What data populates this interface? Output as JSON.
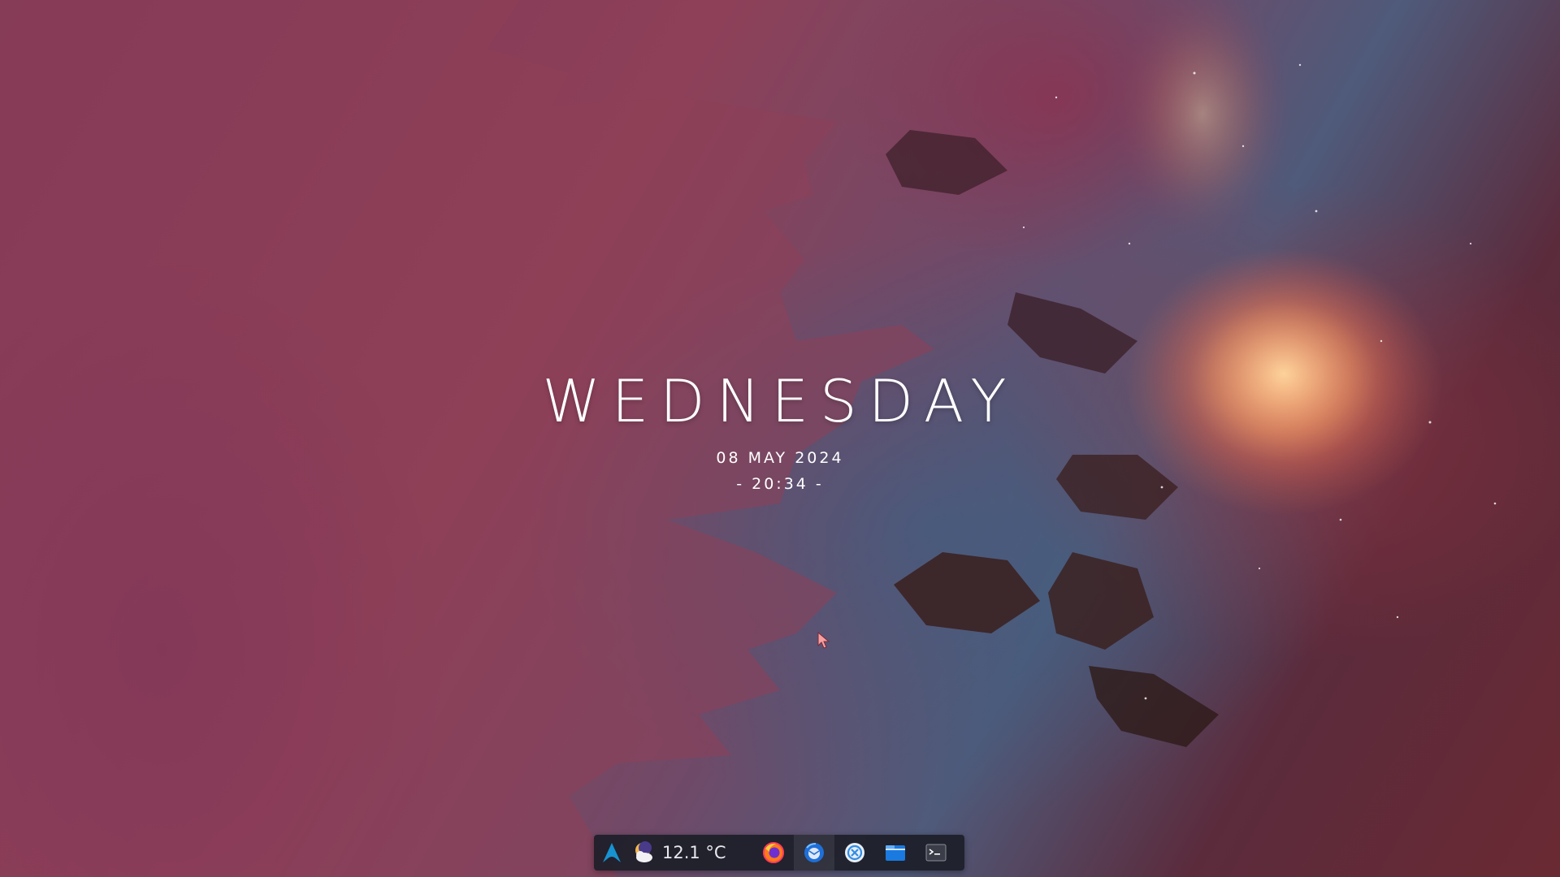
{
  "clock": {
    "day": "WEDNESDAY",
    "date": "08 MAY 2024",
    "time": "- 20:34 -"
  },
  "taskbar": {
    "launcher_icon": "arch-linux-icon",
    "weather": {
      "icon": "weather-night-partly-cloudy-icon",
      "temperature": "12.1 °C"
    },
    "tasks": [
      {
        "icon": "firefox-icon",
        "active": false
      },
      {
        "icon": "thunderbird-icon",
        "active": true
      },
      {
        "icon": "kde-discover-icon",
        "active": false
      },
      {
        "icon": "file-manager-icon",
        "active": false
      },
      {
        "icon": "terminal-icon",
        "active": false
      }
    ]
  },
  "colors": {
    "taskbar_bg": "#1c1e28",
    "text": "#ffffff",
    "accent_blue": "#1793d1"
  }
}
